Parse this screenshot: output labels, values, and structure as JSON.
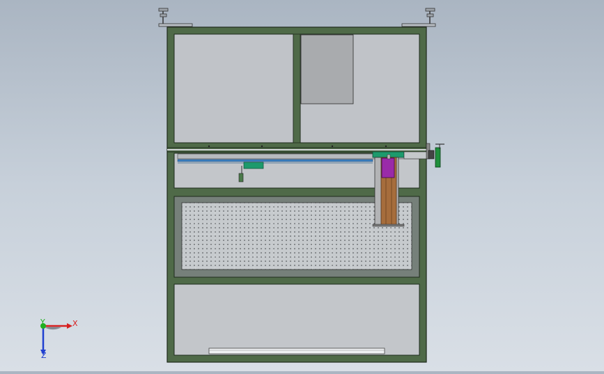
{
  "viewport": {
    "background_top": "#aab5c2",
    "background_bottom": "#d9dfe6"
  },
  "model": {
    "frame_color": "#4f6a48",
    "frame_edge_color": "#1e2a1c",
    "panel_color": "#c3c6ca",
    "mesh_color": "#c8cccf",
    "cylinder_color": "#9a2aa8",
    "accent_green": "#1d9a6c",
    "rod_blue": "#3a7fc0",
    "block_grey": "#b3b4b6"
  },
  "triad": {
    "x_label": "X",
    "y_label": "Y",
    "z_label": "Z",
    "x_color": "#d62020",
    "y_color": "#20b020",
    "z_color": "#2040d0"
  }
}
